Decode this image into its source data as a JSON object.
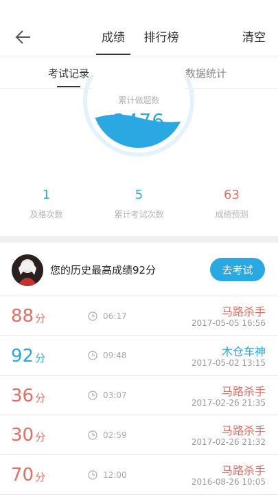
{
  "header": {
    "tabs": [
      {
        "label": "成绩",
        "active": true
      },
      {
        "label": "排行榜",
        "active": false
      }
    ],
    "clear_label": "清空"
  },
  "subtabs": [
    {
      "label": "考试记录",
      "active": true
    },
    {
      "label": "数据统计",
      "active": false
    }
  ],
  "stats": {
    "total_label": "累计做题数",
    "total_value": "2476",
    "metrics": [
      {
        "value": "1",
        "label": "及格次数"
      },
      {
        "value": "5",
        "label": "累计考试次数"
      },
      {
        "value": "63",
        "label": "成绩预测"
      }
    ]
  },
  "best": {
    "text": "您的历史最高成绩92分",
    "button_label": "去考试"
  },
  "records": [
    {
      "score": "88",
      "unit": "分",
      "duration": "06:17",
      "title": "马路杀手",
      "date": "2017-05-05  16:56",
      "color": "#e07064"
    },
    {
      "score": "92",
      "unit": "分",
      "duration": "09:48",
      "title": "木仓车神",
      "date": "2017-05-02  13:15",
      "color": "#29a8e2"
    },
    {
      "score": "36",
      "unit": "分",
      "duration": "03:07",
      "title": "马路杀手",
      "date": "2017-02-26  21:35",
      "color": "#e07064"
    },
    {
      "score": "30",
      "unit": "分",
      "duration": "02:59",
      "title": "马路杀手",
      "date": "2017-02-26  21:32",
      "color": "#e07064"
    },
    {
      "score": "70",
      "unit": "分",
      "duration": "12:00",
      "title": "马路杀手",
      "date": "2016-08-26  10:05",
      "color": "#e07064"
    }
  ],
  "colors": {
    "accent_blue": "#29a8e2",
    "accent_red": "#e07064"
  }
}
